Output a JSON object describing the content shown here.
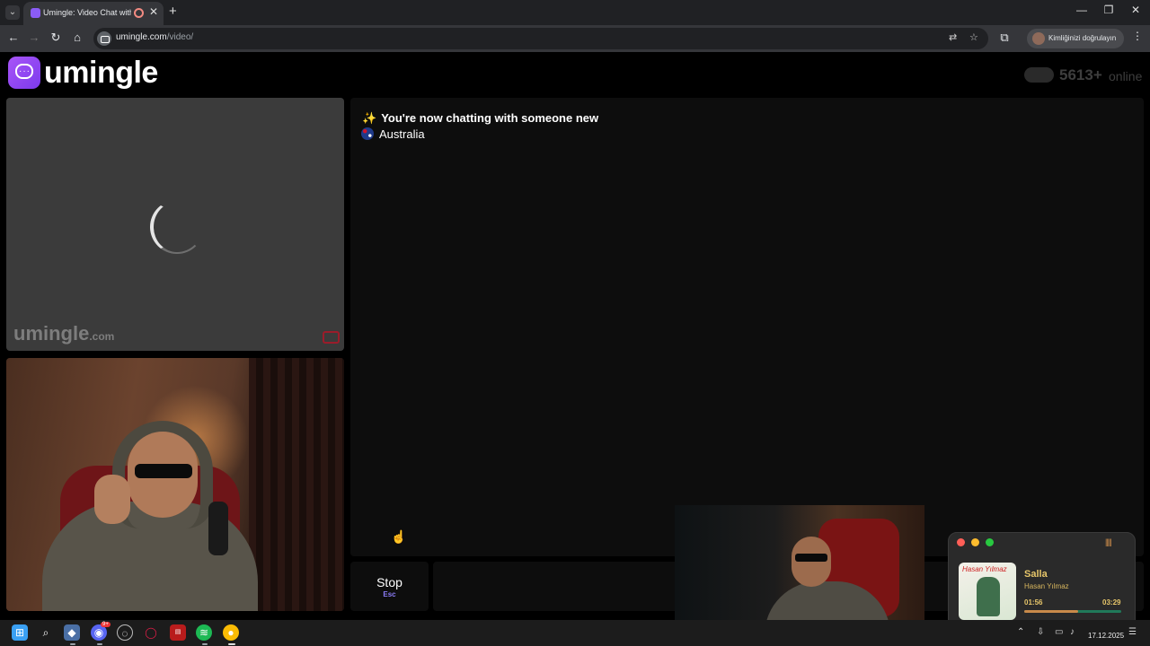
{
  "browser": {
    "tab_title": "Umingle: Video Chat with S",
    "new_tab": "+",
    "close_tab": "✕",
    "url_host": "umingle.com",
    "url_path": "/video/",
    "profile_label": "Kimliğinizi doğrulayın",
    "window_controls": {
      "minimize": "—",
      "restore": "❐",
      "close": "✕"
    }
  },
  "site": {
    "logo_text": "umingle",
    "online_count": "5613+",
    "online_label": "online",
    "watermark": "umingle",
    "watermark_domain": ".com"
  },
  "chat": {
    "status_icon": "✨",
    "status_message": "You're now chatting with someone new",
    "country": "Australia"
  },
  "controls": {
    "stop_label": "Stop",
    "stop_hint": "Esc"
  },
  "music": {
    "album_title": "Hasan Yılmaz",
    "song": "Salla",
    "artist": "Hasan Yılmaz",
    "time_current": "01:56",
    "time_total": "03:29",
    "progress": 0.555,
    "colors": {
      "accent": "#e7c66a",
      "close": "#ff5f57",
      "min": "#febc2e",
      "max": "#28c840"
    }
  },
  "taskbar": {
    "discord_badge": "9+",
    "date": "17.12.2025"
  },
  "colors": {
    "brand": "#8b5cf6",
    "page_bg": "#000000",
    "panel_bg": "#0d0d0d"
  }
}
